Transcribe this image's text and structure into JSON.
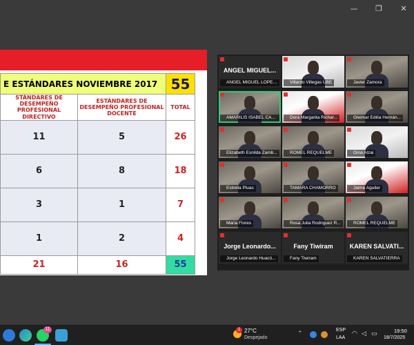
{
  "window": {
    "minimize": "—",
    "restore": "❐",
    "close": "✕"
  },
  "slide": {
    "title": "E ESTÁNDARES NOVIEMBRE 2017",
    "title_badge": "55",
    "headers": [
      "STÁNDARES DE DESEMPEÑO PROFESIONAL DIRECTIVO",
      "ESTÁNDARES DE DESEMPEÑO PROFESIONAL DOCENTE",
      "TOTAL"
    ],
    "rows": [
      [
        "11",
        "5",
        "26"
      ],
      [
        "6",
        "8",
        "18"
      ],
      [
        "3",
        "1",
        "7"
      ],
      [
        "1",
        "2",
        "4"
      ]
    ],
    "footer": [
      "21",
      "16",
      "55"
    ]
  },
  "participants": [
    {
      "big": "ANGEL MIGUEL...",
      "label": "ANGEL MIGUEL LOPEZ..."
    },
    {
      "big": "",
      "label": "Villardo Villegas UBE"
    },
    {
      "big": "",
      "label": "Javier Zamora"
    },
    {
      "big": "",
      "label": "AMARILIS ISABEL CAMPO..."
    },
    {
      "big": "",
      "label": "Dora Margarita Richar..."
    },
    {
      "big": "",
      "label": "Gleimar Edilia Hernán..."
    },
    {
      "big": "",
      "label": "Elizabeth Esnilda Zamb..."
    },
    {
      "big": "",
      "label": "ROMEL REQUELME"
    },
    {
      "big": "",
      "label": "Gina Alzai"
    },
    {
      "big": "",
      "label": "Estrella Pluas"
    },
    {
      "big": "",
      "label": "TAMARA CHAMORRO"
    },
    {
      "big": "",
      "label": "Jaime Aguiler"
    },
    {
      "big": "",
      "label": "Maria Flores"
    },
    {
      "big": "",
      "label": "Rosa Julia Rodriguez R..."
    },
    {
      "big": "",
      "label": "ROMEL REQUELME"
    },
    {
      "big": "Jorge Leonardo...",
      "label": "Jorge Leonardo Huacó..."
    },
    {
      "big": "Fany Tiwiram",
      "label": "Fany Tiwiram"
    },
    {
      "big": "KAREN SALVATI...",
      "label": "KAREN SALVATIERRA"
    }
  ],
  "taskbar": {
    "whatsapp_badge": "11",
    "weather_badge": "1",
    "temperature": "27°C",
    "condition": "Despejado",
    "lang_primary": "ESP",
    "lang_secondary": "LAA",
    "time": "19:50",
    "date": "18/7/2025"
  }
}
